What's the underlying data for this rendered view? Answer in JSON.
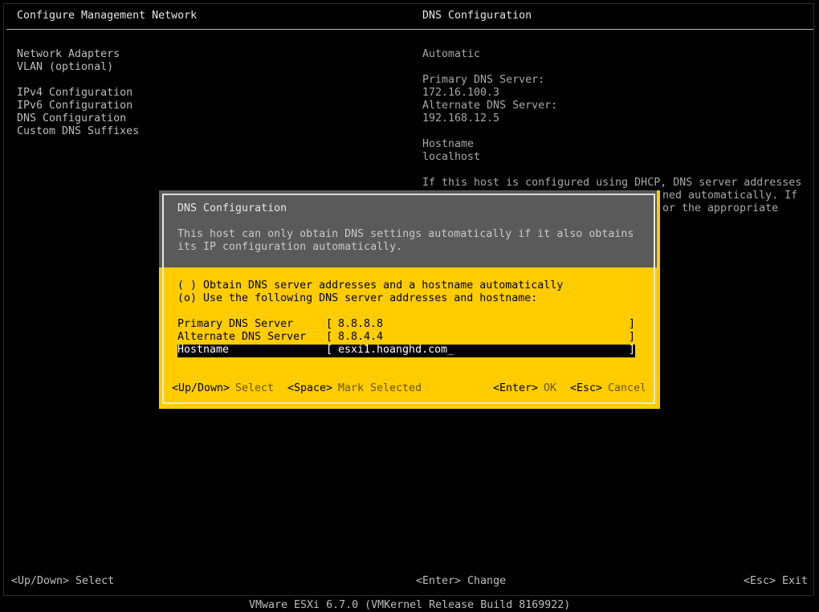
{
  "header": {
    "title": "Configure Management Network",
    "right_title": "DNS Configuration"
  },
  "menu": {
    "items": [
      {
        "label": "Network Adapters"
      },
      {
        "label": "VLAN (optional)"
      },
      {
        "label": "IPv4 Configuration"
      },
      {
        "label": "IPv6 Configuration"
      },
      {
        "label": "DNS Configuration"
      },
      {
        "label": "Custom DNS Suffixes"
      }
    ]
  },
  "info": {
    "mode": "Automatic",
    "primary_label": "Primary DNS Server:",
    "primary_value": "172.16.100.3",
    "alternate_label": "Alternate DNS Server:",
    "alternate_value": "192.168.12.5",
    "hostname_label": "Hostname",
    "hostname_value": "localhost",
    "note_line1": "If this host is configured using DHCP, DNS server addresses",
    "note_line2": "ned automatically. If",
    "note_line3": "or the appropriate"
  },
  "dialog": {
    "title": "DNS Configuration",
    "desc_line1": "This host can only obtain DNS settings automatically if it also obtains",
    "desc_line2": "its IP configuration automatically.",
    "option_auto": "( ) Obtain DNS server addresses and a hostname automatically",
    "option_manual": "(o) Use the following DNS server addresses and hostname:",
    "fields": [
      {
        "label": "Primary DNS Server",
        "value": "8.8.8.8"
      },
      {
        "label": "Alternate DNS Server",
        "value": "8.8.4.4"
      },
      {
        "label": "Hostname",
        "value": "esxi1.hoanghd.com_"
      }
    ],
    "bracket_open": "[",
    "bracket_close": "]",
    "footer": {
      "updown_key": "<Up/Down>",
      "updown_action": "Select",
      "space_key": "<Space>",
      "space_action": "Mark Selected",
      "enter_key": "<Enter>",
      "enter_action": "OK",
      "esc_key": "<Esc>",
      "esc_action": "Cancel"
    }
  },
  "footer": {
    "left": "<Up/Down> Select",
    "center": "<Enter> Change",
    "right": "<Esc> Exit",
    "build": "VMware ESXi 6.7.0 (VMKernel Release Build 8169922)"
  },
  "colors": {
    "background": "#000000",
    "dialog_body": "#ffcc00",
    "dialog_header": "#5a5a5a",
    "text": "#bdbdbd"
  }
}
